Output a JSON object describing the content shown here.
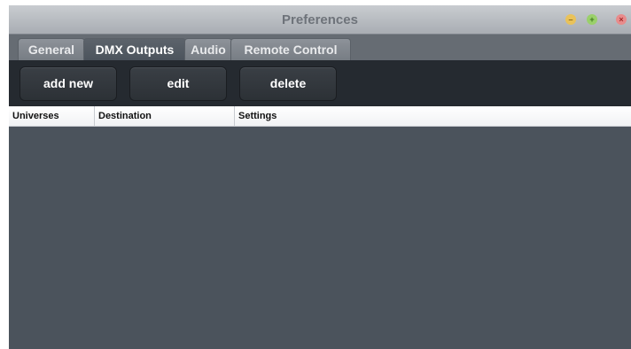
{
  "window": {
    "title": "Preferences"
  },
  "window_controls": {
    "minimize_glyph": "–",
    "maximize_glyph": "+",
    "close_glyph": "×"
  },
  "tabs": [
    {
      "label": "General"
    },
    {
      "label": "DMX Outputs",
      "active": true
    },
    {
      "label": "Audio"
    },
    {
      "label": "Remote Control"
    }
  ],
  "toolbar": {
    "add_label": "add new",
    "edit_label": "edit",
    "delete_label": "delete"
  },
  "table": {
    "columns": [
      "Universes",
      "Destination",
      "Settings"
    ],
    "rows": []
  }
}
